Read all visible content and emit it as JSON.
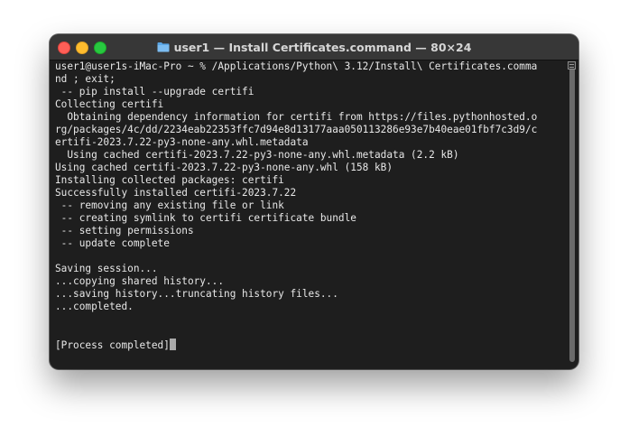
{
  "window": {
    "title": "user1 — Install Certificates.command — 80×24"
  },
  "colors": {
    "close": "#fe5f57",
    "minimize": "#febc2e",
    "maximize": "#28c840",
    "background": "#1e1e1e",
    "text": "#e8e8e8"
  },
  "terminal": {
    "lines": [
      "user1@user1s-iMac-Pro ~ % /Applications/Python\\ 3.12/Install\\ Certificates.comma",
      "nd ; exit;",
      " -- pip install --upgrade certifi",
      "Collecting certifi",
      "  Obtaining dependency information for certifi from https://files.pythonhosted.o",
      "rg/packages/4c/dd/2234eab22353ffc7d94e8d13177aaa050113286e93e7b40eae01fbf7c3d9/c",
      "ertifi-2023.7.22-py3-none-any.whl.metadata",
      "  Using cached certifi-2023.7.22-py3-none-any.whl.metadata (2.2 kB)",
      "Using cached certifi-2023.7.22-py3-none-any.whl (158 kB)",
      "Installing collected packages: certifi",
      "Successfully installed certifi-2023.7.22",
      " -- removing any existing file or link",
      " -- creating symlink to certifi certificate bundle",
      " -- setting permissions",
      " -- update complete",
      "",
      "Saving session...",
      "...copying shared history...",
      "...saving history...truncating history files...",
      "...completed.",
      "",
      "",
      "[Process completed]"
    ]
  }
}
